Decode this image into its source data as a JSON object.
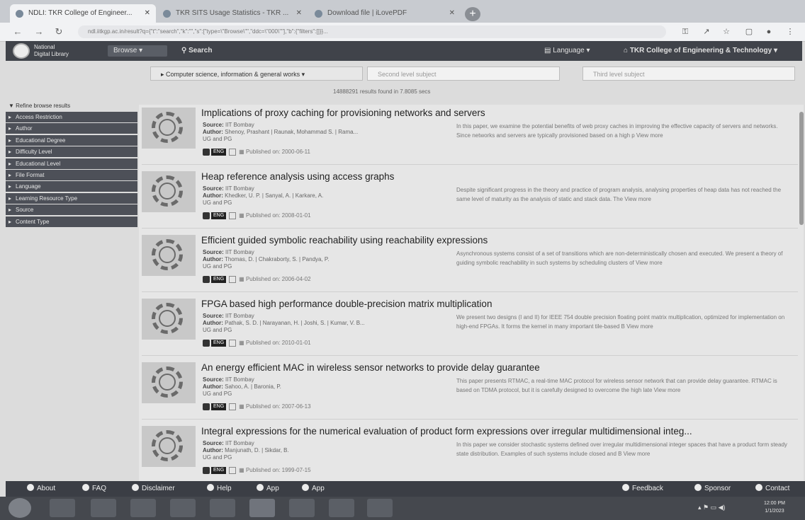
{
  "browser": {
    "tabs": [
      {
        "label": "NDLI: TKR College of Engineer...",
        "active": true
      },
      {
        "label": "TKR SITS Usage Statistics - TKR ...",
        "active": false
      },
      {
        "label": "Download file | iLovePDF",
        "active": false
      }
    ],
    "new_tab_label": "+",
    "url": "ndl.iitkgp.ac.in/result?q={\"t\":\"search\",\"k\":\"\",\"s\":[\"type=\\\"Browse\\\"\",\"ddc=\\\"000\\\"\"],\"b\":{\"filters\":[]}}..."
  },
  "site": {
    "logo_line1": "National",
    "logo_line2": "Digital Library",
    "browse_label": "Browse",
    "search_label": "Search",
    "language_label": "Language",
    "institution_label": "TKR College of Engineering & Technology"
  },
  "filters": {
    "first_level": "Computer science, information & general works",
    "second_level": "Second level subject",
    "third_level": "Third level subject"
  },
  "results_count": "14888291 results found in 7.8085 secs",
  "refine": {
    "title": "Refine browse results",
    "facets": [
      "Access Restriction",
      "Author",
      "Educational Degree",
      "Difficulty Level",
      "Educational Level",
      "File Format",
      "Language",
      "Learning Resource Type",
      "Source",
      "Content Type"
    ]
  },
  "results": [
    {
      "title": "Implications of proxy caching for provisioning networks and servers",
      "source": "IIT Bombay",
      "author": "Shenoy, Prashant | Raunak, Mohammad S. | Rama...",
      "level": "UG and PG",
      "lang": "ENG",
      "published": "Published on: 2000-06-11",
      "abstract": "In this paper, we examine the potential benefits of web proxy caches in improving the effective capacity of servers and networks. Since networks and servers are typically provisioned based on a high p View more"
    },
    {
      "title": "Heap reference analysis using access graphs",
      "source": "IIT Bombay",
      "author": "Khedker, U. P. | Sanyal, A. | Karkare, A.",
      "level": "UG and PG",
      "lang": "ENG",
      "published": "Published on: 2008-01-01",
      "abstract": "Despite significant progress in the theory and practice of program analysis, analysing properties of heap data has not reached the same level of maturity as the analysis of static and stack data. The View more"
    },
    {
      "title": "Efficient guided symbolic reachability using reachability expressions",
      "source": "IIT Bombay",
      "author": "Thomas, D. | Chakraborty, S. | Pandya, P.",
      "level": "UG and PG",
      "lang": "ENG",
      "published": "Published on: 2006-04-02",
      "abstract": "Asynchronous systems consist of a set of transitions which are non-deterministically chosen and executed. We present a theory of guiding symbolic reachability in such systems by scheduling clusters of View more"
    },
    {
      "title": "FPGA based high performance double-precision matrix multiplication",
      "source": "IIT Bombay",
      "author": "Pathak, S. D. | Narayanan, H. | Joshi, S. | Kumar, V. B...",
      "level": "UG and PG",
      "lang": "ENG",
      "published": "Published on: 2010-01-01",
      "abstract": "We present two designs (I and II) for IEEE 754 double precision floating point matrix multiplication, optimized for implementation on high-end FPGAs. It forms the kernel in many important tile-based B View more"
    },
    {
      "title": "An energy efficient MAC in wireless sensor networks to provide delay guarantee",
      "source": "IIT Bombay",
      "author": "Sahoo, A. | Baronia, P.",
      "level": "UG and PG",
      "lang": "ENG",
      "published": "Published on: 2007-06-13",
      "abstract": "This paper presents RTMAC, a real-time MAC protocol for wireless sensor network that can provide delay guarantee. RTMAC is based on TDMA protocol, but it is carefully designed to overcome the high late View more"
    },
    {
      "title": "Integral expressions for the numerical evaluation of product form expressions over irregular multidimensional integ...",
      "source": "IIT Bombay",
      "author": "Manjunath, D. | Sikdar, B.",
      "level": "UG and PG",
      "lang": "ENG",
      "published": "Published on: 1999-07-15",
      "abstract": "In this paper we consider stochastic systems defined over irregular multidimensional integer spaces that have a product form steady state distribution. Examples of such systems include closed and B View more"
    }
  ],
  "footer": {
    "about": "About",
    "faq": "FAQ",
    "disclaimer": "Disclaimer",
    "help": "Help",
    "app1": "App",
    "app2": "App",
    "feedback": "Feedback",
    "sponsor": "Sponsor",
    "contact": "Contact"
  },
  "taskbar": {
    "time": "12:00 PM",
    "date": "1/1/2023"
  },
  "labels": {
    "source": "Source:",
    "author": "Author:"
  },
  "colors": {
    "header_bg": "#40434a",
    "facet_bg": "#4d5058",
    "footer_bg": "#3b3e45"
  }
}
